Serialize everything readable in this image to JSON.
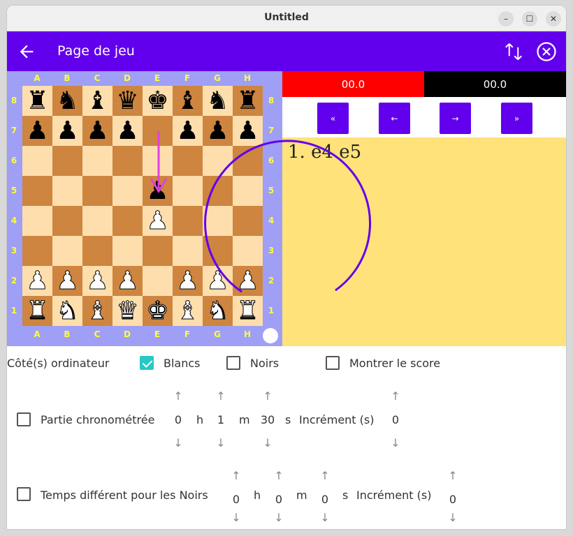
{
  "window": {
    "title": "Untitled"
  },
  "appbar": {
    "title": "Page de jeu"
  },
  "board": {
    "files": [
      "A",
      "B",
      "C",
      "D",
      "E",
      "F",
      "G",
      "H"
    ],
    "ranks": [
      "8",
      "7",
      "6",
      "5",
      "4",
      "3",
      "2",
      "1"
    ],
    "rows": [
      [
        "bR",
        "bN",
        "bB",
        "bQ",
        "bK",
        "bB",
        "bN",
        "bR"
      ],
      [
        "bP",
        "bP",
        "bP",
        "bP",
        "",
        "bP",
        "bP",
        "bP"
      ],
      [
        "",
        "",
        "",
        "",
        "",
        "",
        "",
        ""
      ],
      [
        "",
        "",
        "",
        "",
        "bP",
        "",
        "",
        ""
      ],
      [
        "",
        "",
        "",
        "",
        "wP",
        "",
        "",
        ""
      ],
      [
        "",
        "",
        "",
        "",
        "",
        "",
        "",
        ""
      ],
      [
        "wP",
        "wP",
        "wP",
        "wP",
        "",
        "wP",
        "wP",
        "wP"
      ],
      [
        "wR",
        "wN",
        "wB",
        "wQ",
        "wK",
        "wB",
        "wN",
        "wR"
      ]
    ],
    "last_move_arrow": {
      "from": "e7",
      "to": "e5",
      "color": "#e040e0"
    }
  },
  "clocks": {
    "white": "00.0",
    "black": "00.0",
    "white_bg": "#ff0000",
    "black_bg": "#000000"
  },
  "nav": {
    "first": "«",
    "prev": "←",
    "next": "→",
    "last": "»"
  },
  "history": {
    "moves": "1. e4 e5"
  },
  "options": {
    "computer_sides": "Côté(s) ordinateur",
    "whites": "Blancs",
    "blacks": "Noirs",
    "show_score": "Montrer le score"
  },
  "timed": {
    "label": "Partie chronométrée",
    "hours": "0",
    "h": "h",
    "minutes": "1",
    "m": "m",
    "seconds": "30",
    "s": "s",
    "increment_label": "Incrément (s)",
    "increment": "0"
  },
  "black_time": {
    "label": "Temps différent pour les Noirs",
    "hours": "0",
    "h": "h",
    "minutes": "0",
    "m": "m",
    "seconds": "0",
    "s": "s",
    "increment_label": "Incrément (s)",
    "increment": "0"
  },
  "colors": {
    "accent": "#6200ee",
    "board_frame": "#9f9ff5",
    "history_bg": "#ffe27a",
    "check": "#26c9c3"
  }
}
